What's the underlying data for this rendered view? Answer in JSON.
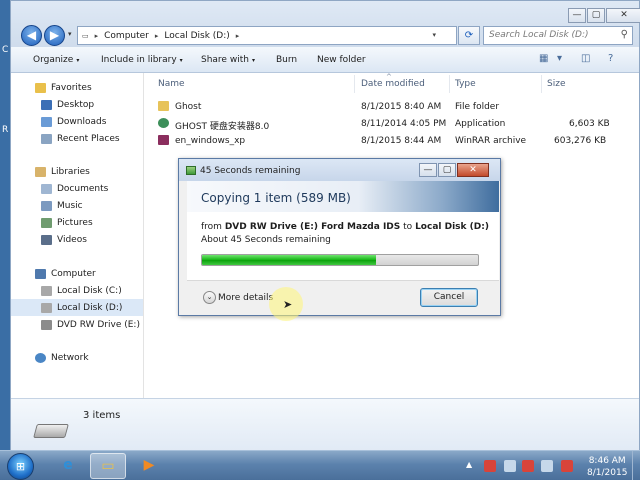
{
  "desktop": {
    "frag_top": "C",
    "frag_mid": "R"
  },
  "window": {
    "controls": {
      "minimize": "—",
      "maximize": "▢",
      "close": "✕"
    },
    "nav": {
      "back": "◀",
      "forward": "▶",
      "dropdown": "▾"
    },
    "address": {
      "segments": [
        "Computer",
        "Local Disk (D:)"
      ],
      "separator": "▸",
      "dropdown": "▾"
    },
    "refresh": "⟳",
    "search": {
      "placeholder": "Search Local Disk (D:)",
      "icon": "⚲"
    },
    "toolbar": {
      "organize": "Organize",
      "include_in_library": "Include in library",
      "share_with": "Share with",
      "burn": "Burn",
      "new_folder": "New folder",
      "caret": "▾"
    }
  },
  "navpane": {
    "favorites": {
      "label": "Favorites",
      "items": [
        "Desktop",
        "Downloads",
        "Recent Places"
      ]
    },
    "libraries": {
      "label": "Libraries",
      "items": [
        "Documents",
        "Music",
        "Pictures",
        "Videos"
      ]
    },
    "computer": {
      "label": "Computer",
      "items": [
        "Local Disk (C:)",
        "Local Disk (D:)",
        "DVD RW Drive (E:) Fo"
      ]
    },
    "network": {
      "label": "Network"
    }
  },
  "filelist": {
    "columns": [
      "Name",
      "Date modified",
      "Type",
      "Size"
    ],
    "sort_indicator": "^",
    "rows": [
      {
        "name": "Ghost",
        "date": "8/1/2015 8:40 AM",
        "type": "File folder",
        "size": "",
        "icon_color": "#e7c35a"
      },
      {
        "name": "GHOST 硬盘安装器8.0",
        "date": "8/11/2014 4:05 PM",
        "type": "Application",
        "size": "6,603 KB",
        "icon_color": "#3d8f5a"
      },
      {
        "name": "en_windows_xp",
        "date": "8/1/2015 8:44 AM",
        "type": "WinRAR archive",
        "size": "603,276 KB",
        "icon_color": "#8b2e5e"
      }
    ]
  },
  "status": {
    "items": "3 items"
  },
  "dialog": {
    "title": "45 Seconds remaining",
    "heading": "Copying 1 item (589 MB)",
    "from_prefix": "from",
    "source": "DVD RW Drive (E:) Ford Mazda IDS",
    "to_word": "to",
    "destination": "Local Disk (D:)",
    "remaining": "About 45 Seconds remaining",
    "progress_fraction": 0.63,
    "more_details": "More details",
    "more_icon": "⌄",
    "cancel": "Cancel",
    "controls": {
      "minimize": "—",
      "maximize": "▢",
      "close": "✕"
    }
  },
  "taskbar": {
    "start_icon": "⊞",
    "apps": [
      "e",
      "▭",
      "▶"
    ],
    "clock_time": "8:46 AM",
    "clock_date": "8/1/2015"
  },
  "colors": {
    "accent": "#1d5fbc",
    "progress": "#14b514",
    "selection": "#dbe8f7"
  }
}
